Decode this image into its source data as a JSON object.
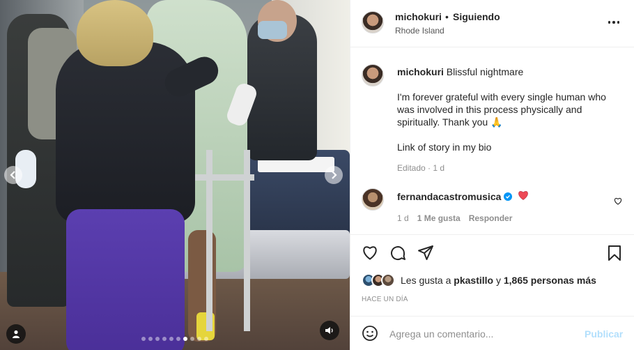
{
  "header": {
    "username": "michokuri",
    "separator": "•",
    "follow_status": "Siguiendo",
    "location": "Rhode Island"
  },
  "caption": {
    "username": "michokuri",
    "title": "Blissful nightmare",
    "paragraph1": "I'm forever grateful with every single human who was involved in this process physically and spiritually. Thank you 🙏",
    "paragraph2": "Link of story in my bio",
    "edited": "Editado",
    "time": "1 d"
  },
  "comment": {
    "username": "fernandacastromusica",
    "emoji": "❤️",
    "time": "1 d",
    "likes": "1 Me gusta",
    "reply": "Responder"
  },
  "likes": {
    "prefix": "Les gusta a",
    "user": "pkastillo",
    "connector": "y",
    "others": "1,865 personas más"
  },
  "timestamp": "HACE UN DÍA",
  "add_comment": {
    "placeholder": "Agrega un comentario...",
    "post_label": "Publicar"
  },
  "carousel": {
    "count": 10,
    "active_index": 6
  },
  "colors": {
    "verified": "#0095f6",
    "post_disabled": "#b2dffc",
    "heart": "#ed4956"
  }
}
